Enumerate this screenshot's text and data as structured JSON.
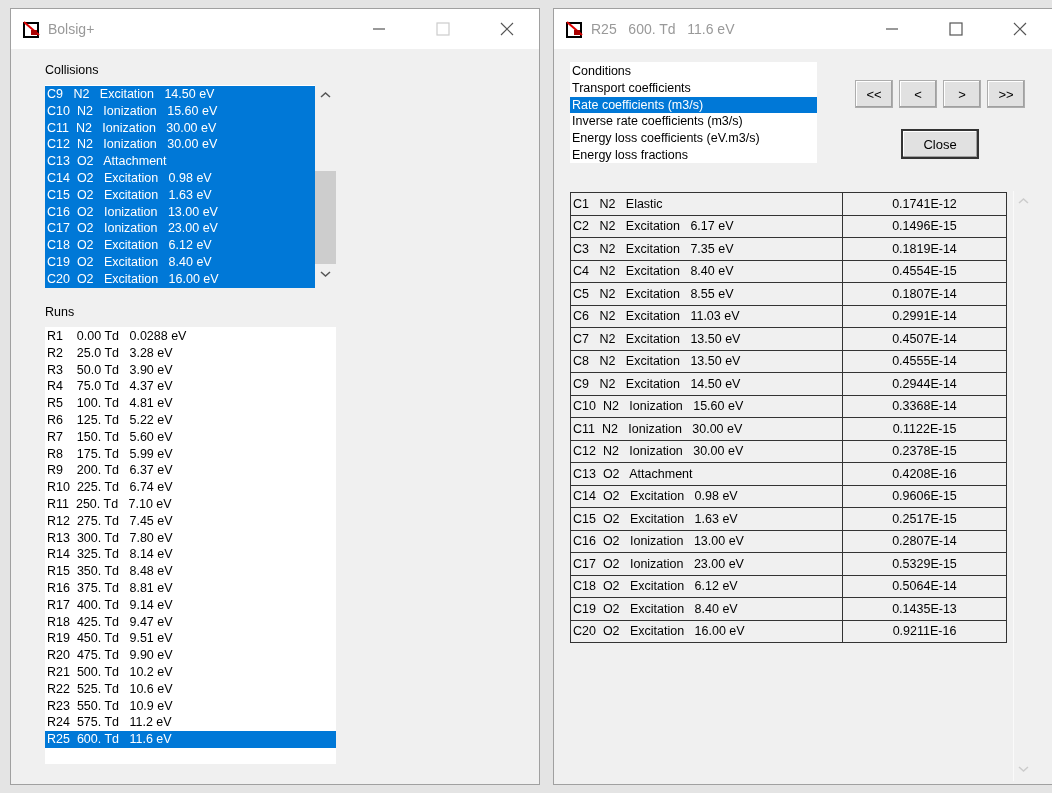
{
  "main_window": {
    "title": "Bolsig+",
    "maximize_enabled": false,
    "collisions": {
      "label": "Collisions",
      "items": [
        {
          "text": "C9   N2   Excitation   14.50 eV",
          "selected": true
        },
        {
          "text": "C10  N2   Ionization   15.60 eV",
          "selected": true
        },
        {
          "text": "C11  N2   Ionization   30.00 eV",
          "selected": true
        },
        {
          "text": "C12  N2   Ionization   30.00 eV",
          "selected": true
        },
        {
          "text": "C13  O2   Attachment",
          "selected": true
        },
        {
          "text": "C14  O2   Excitation   0.98 eV",
          "selected": true
        },
        {
          "text": "C15  O2   Excitation   1.63 eV",
          "selected": true
        },
        {
          "text": "C16  O2   Ionization   13.00 eV",
          "selected": true
        },
        {
          "text": "C17  O2   Ionization   23.00 eV",
          "selected": true
        },
        {
          "text": "C18  O2   Excitation   6.12 eV",
          "selected": true
        },
        {
          "text": "C19  O2   Excitation   8.40 eV",
          "selected": true
        },
        {
          "text": "C20  O2   Excitation   16.00 eV",
          "selected": true
        }
      ]
    },
    "runs": {
      "label": "Runs",
      "items": [
        {
          "text": "R1    0.00 Td   0.0288 eV",
          "selected": false
        },
        {
          "text": "R2    25.0 Td   3.28 eV",
          "selected": false
        },
        {
          "text": "R3    50.0 Td   3.90 eV",
          "selected": false
        },
        {
          "text": "R4    75.0 Td   4.37 eV",
          "selected": false
        },
        {
          "text": "R5    100. Td   4.81 eV",
          "selected": false
        },
        {
          "text": "R6    125. Td   5.22 eV",
          "selected": false
        },
        {
          "text": "R7    150. Td   5.60 eV",
          "selected": false
        },
        {
          "text": "R8    175. Td   5.99 eV",
          "selected": false
        },
        {
          "text": "R9    200. Td   6.37 eV",
          "selected": false
        },
        {
          "text": "R10  225. Td   6.74 eV",
          "selected": false
        },
        {
          "text": "R11  250. Td   7.10 eV",
          "selected": false
        },
        {
          "text": "R12  275. Td   7.45 eV",
          "selected": false
        },
        {
          "text": "R13  300. Td   7.80 eV",
          "selected": false
        },
        {
          "text": "R14  325. Td   8.14 eV",
          "selected": false
        },
        {
          "text": "R15  350. Td   8.48 eV",
          "selected": false
        },
        {
          "text": "R16  375. Td   8.81 eV",
          "selected": false
        },
        {
          "text": "R17  400. Td   9.14 eV",
          "selected": false
        },
        {
          "text": "R18  425. Td   9.47 eV",
          "selected": false
        },
        {
          "text": "R19  450. Td   9.51 eV",
          "selected": false
        },
        {
          "text": "R20  475. Td   9.90 eV",
          "selected": false
        },
        {
          "text": "R21  500. Td   10.2 eV",
          "selected": false
        },
        {
          "text": "R22  525. Td   10.6 eV",
          "selected": false
        },
        {
          "text": "R23  550. Td   10.9 eV",
          "selected": false
        },
        {
          "text": "R24  575. Td   11.2 eV",
          "selected": false
        },
        {
          "text": "R25  600. Td   11.6 eV",
          "selected": true
        }
      ]
    }
  },
  "results_window": {
    "title": "R25   600. Td   11.6 eV",
    "maximize_enabled": true,
    "views": [
      {
        "label": "Conditions",
        "selected": false
      },
      {
        "label": "Transport coefficients",
        "selected": false
      },
      {
        "label": "Rate coefficients (m3/s)",
        "selected": true
      },
      {
        "label": "Inverse rate coefficients (m3/s)",
        "selected": false
      },
      {
        "label": "Energy loss coefficients (eV.m3/s)",
        "selected": false
      },
      {
        "label": "Energy loss fractions",
        "selected": false
      }
    ],
    "nav_buttons": [
      "<<",
      "<",
      ">",
      ">>"
    ],
    "close_button": "Close",
    "table": {
      "rows": [
        {
          "collision": "C1   N2   Elastic",
          "value": "0.1741E-12"
        },
        {
          "collision": "C2   N2   Excitation   6.17 eV",
          "value": "0.1496E-15"
        },
        {
          "collision": "C3   N2   Excitation   7.35 eV",
          "value": "0.1819E-14"
        },
        {
          "collision": "C4   N2   Excitation   8.40 eV",
          "value": "0.4554E-15"
        },
        {
          "collision": "C5   N2   Excitation   8.55 eV",
          "value": "0.1807E-14"
        },
        {
          "collision": "C6   N2   Excitation   11.03 eV",
          "value": "0.2991E-14"
        },
        {
          "collision": "C7   N2   Excitation   13.50 eV",
          "value": "0.4507E-14"
        },
        {
          "collision": "C8   N2   Excitation   13.50 eV",
          "value": "0.4555E-14"
        },
        {
          "collision": "C9   N2   Excitation   14.50 eV",
          "value": "0.2944E-14"
        },
        {
          "collision": "C10  N2   Ionization   15.60 eV",
          "value": "0.3368E-14"
        },
        {
          "collision": "C11  N2   Ionization   30.00 eV",
          "value": "0.1122E-15"
        },
        {
          "collision": "C12  N2   Ionization   30.00 eV",
          "value": "0.2378E-15"
        },
        {
          "collision": "C13  O2   Attachment",
          "value": "0.4208E-16"
        },
        {
          "collision": "C14  O2   Excitation   0.98 eV",
          "value": "0.9606E-15"
        },
        {
          "collision": "C15  O2   Excitation   1.63 eV",
          "value": "0.2517E-15"
        },
        {
          "collision": "C16  O2   Ionization   13.00 eV",
          "value": "0.2807E-14"
        },
        {
          "collision": "C17  O2   Ionization   23.00 eV",
          "value": "0.5329E-15"
        },
        {
          "collision": "C18  O2   Excitation   6.12 eV",
          "value": "0.5064E-14"
        },
        {
          "collision": "C19  O2   Excitation   8.40 eV",
          "value": "0.1435E-13"
        },
        {
          "collision": "C20  O2   Excitation   16.00 eV",
          "value": "0.9211E-16"
        }
      ]
    }
  }
}
